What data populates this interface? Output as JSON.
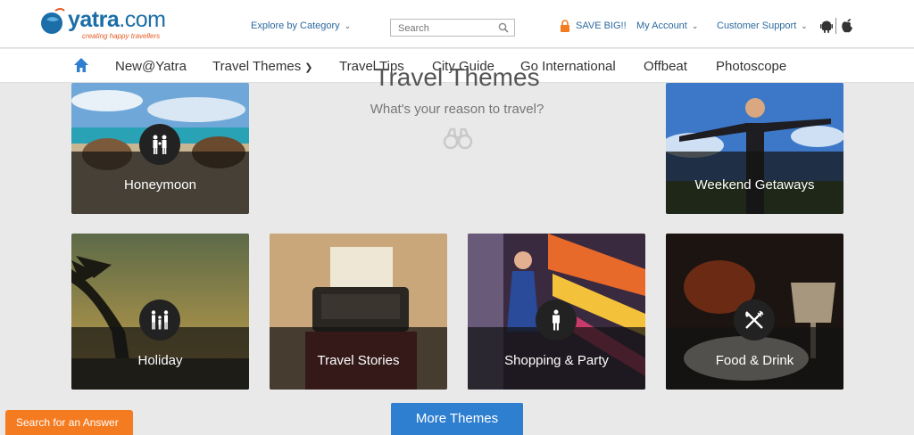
{
  "header": {
    "logo_text": "yatra",
    "logo_domain": ".com",
    "logo_tagline": "creating happy travellers",
    "explore_label": "Explore by Category",
    "search_placeholder": "Search",
    "save_big_label": "SAVE BIG!!",
    "account_label": "My Account",
    "support_label": "Customer Support"
  },
  "nav": {
    "items": [
      "New@Yatra",
      "Travel Themes",
      "Travel Tips",
      "City Guide",
      "Go International",
      "Offbeat",
      "Photoscope"
    ]
  },
  "section": {
    "title": "Travel Themes",
    "subtitle": "What's your reason to travel?"
  },
  "tiles": [
    {
      "label": "Honeymoon",
      "icon": "couple-icon"
    },
    {
      "label": "Weekend Getaways",
      "icon": "none"
    },
    {
      "label": "Holiday",
      "icon": "family-icon"
    },
    {
      "label": "Travel Stories",
      "icon": "none"
    },
    {
      "label": "Shopping & Party",
      "icon": "person-icon"
    },
    {
      "label": "Food & Drink",
      "icon": "fork-knife-icon"
    }
  ],
  "buttons": {
    "more_themes": "More Themes",
    "search_answer": "Search for an Answer"
  },
  "colors": {
    "brand_blue": "#1b6ea8",
    "link_blue": "#2d6a9f",
    "orange": "#f47b20",
    "button_blue": "#2f7fd1"
  }
}
